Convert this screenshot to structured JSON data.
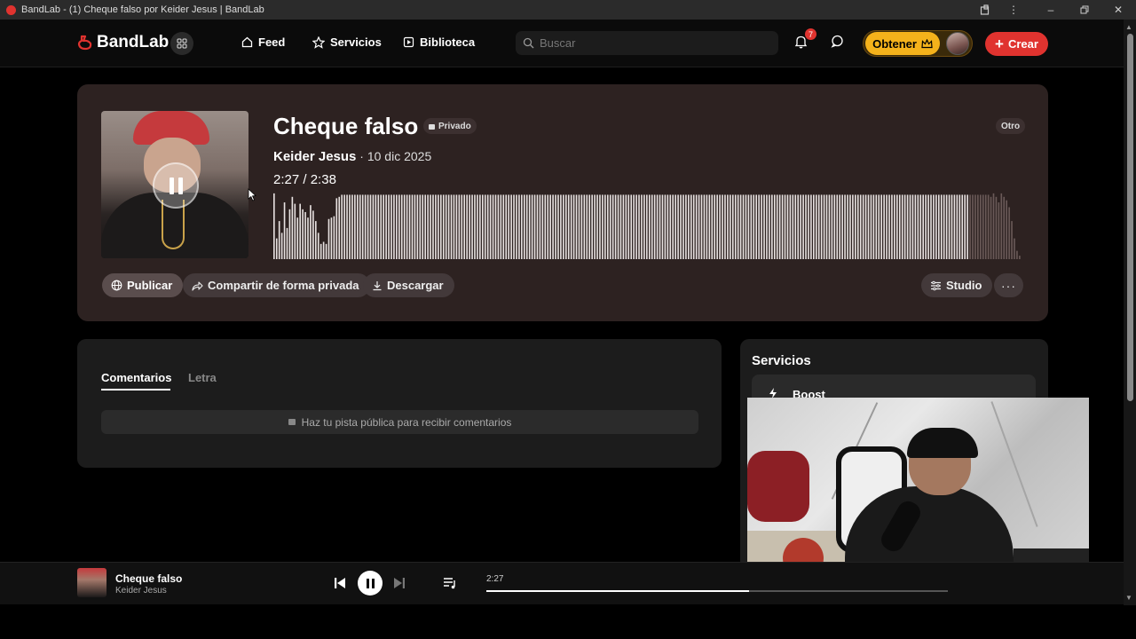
{
  "window": {
    "title": "BandLab - (1) Cheque falso por Keider Jesus | BandLab"
  },
  "nav": {
    "brand": "BandLab",
    "links": [
      {
        "label": "Feed",
        "icon": "home-icon"
      },
      {
        "label": "Servicios",
        "icon": "star-icon"
      },
      {
        "label": "Biblioteca",
        "icon": "library-icon"
      }
    ],
    "search_placeholder": "Buscar",
    "notification_count": "7",
    "get_label": "Obtener",
    "create_label": "Crear"
  },
  "track": {
    "title": "Cheque falso",
    "privacy": "Privado",
    "genre": "Otro",
    "artist": "Keider Jesus",
    "date": " · 10 dic 2025",
    "current_time": "2:27",
    "separator": " /  ",
    "duration": "2:38",
    "progress": 0.93,
    "waveform_levels": [
      0.95,
      0.3,
      0.55,
      0.38,
      0.82,
      0.45,
      0.72,
      0.9,
      0.8,
      0.6,
      0.8,
      0.72,
      0.68,
      0.6,
      0.78,
      0.7,
      0.55,
      0.38,
      0.22,
      0.25,
      0.22,
      0.58,
      0.6,
      0.62,
      0.88,
      0.9,
      0.93,
      0.93,
      0.93,
      0.93,
      0.93,
      0.93,
      0.93,
      0.93,
      0.93,
      0.93,
      0.93,
      0.93,
      0.93,
      0.93,
      0.93,
      0.93,
      0.93,
      0.93,
      0.93,
      0.93,
      0.93,
      0.93,
      0.93,
      0.93,
      0.93,
      0.93,
      0.93,
      0.93,
      0.93,
      0.93,
      0.93,
      0.93,
      0.93,
      0.93,
      0.93,
      0.93,
      0.93,
      0.93,
      0.93,
      0.93,
      0.93,
      0.93,
      0.93,
      0.93,
      0.93,
      0.93,
      0.93,
      0.93,
      0.93,
      0.93,
      0.93,
      0.93,
      0.93,
      0.93,
      0.93,
      0.93,
      0.93,
      0.93,
      0.93,
      0.93,
      0.93,
      0.93,
      0.93,
      0.93,
      0.93,
      0.93,
      0.93,
      0.93,
      0.93,
      0.93,
      0.93,
      0.93,
      0.93,
      0.93,
      0.93,
      0.93,
      0.93,
      0.93,
      0.93,
      0.93,
      0.93,
      0.93,
      0.93,
      0.93,
      0.93,
      0.93,
      0.93,
      0.93,
      0.93,
      0.93,
      0.93,
      0.93,
      0.93,
      0.93,
      0.93,
      0.93,
      0.93,
      0.93,
      0.93,
      0.93,
      0.93,
      0.93,
      0.93,
      0.93,
      0.93,
      0.93,
      0.93,
      0.93,
      0.93,
      0.93,
      0.93,
      0.93,
      0.93,
      0.93,
      0.93,
      0.93,
      0.93,
      0.93,
      0.93,
      0.93,
      0.93,
      0.93,
      0.93,
      0.93,
      0.93,
      0.93,
      0.93,
      0.93,
      0.93,
      0.93,
      0.93,
      0.93,
      0.93,
      0.93,
      0.93,
      0.93,
      0.93,
      0.93,
      0.93,
      0.93,
      0.93,
      0.93,
      0.93,
      0.93,
      0.93,
      0.93,
      0.93,
      0.93,
      0.93,
      0.93,
      0.93,
      0.93,
      0.93,
      0.93,
      0.93,
      0.93,
      0.93,
      0.93,
      0.93,
      0.93,
      0.93,
      0.93,
      0.93,
      0.93,
      0.93,
      0.93,
      0.93,
      0.93,
      0.93,
      0.93,
      0.93,
      0.93,
      0.93,
      0.93,
      0.93,
      0.93,
      0.93,
      0.93,
      0.93,
      0.93,
      0.93,
      0.93,
      0.93,
      0.93,
      0.93,
      0.93,
      0.93,
      0.93,
      0.93,
      0.93,
      0.93,
      0.93,
      0.93,
      0.93,
      0.93,
      0.93,
      0.93,
      0.93,
      0.93,
      0.93,
      0.93,
      0.93,
      0.93,
      0.93,
      0.93,
      0.93,
      0.93,
      0.93,
      0.93,
      0.93,
      0.93,
      0.93,
      0.93,
      0.93,
      0.93,
      0.93,
      0.93,
      0.93,
      0.93,
      0.93,
      0.93,
      0.93,
      0.93,
      0.93,
      0.93,
      0.93,
      0.93,
      0.93,
      0.93,
      0.93,
      0.93,
      0.93,
      0.93,
      0.93,
      0.93,
      0.93,
      0.93,
      0.93,
      0.93,
      0.93,
      0.93,
      0.93,
      0.93,
      0.93,
      0.93,
      0.93,
      0.93,
      0.93,
      0.93,
      0.9,
      0.95,
      0.9,
      0.82,
      0.95,
      0.9,
      0.85,
      0.75,
      0.55,
      0.3,
      0.12,
      0.05
    ]
  },
  "actions": {
    "publish": "Publicar",
    "share_private": "Compartir de forma privada",
    "download": "Descargar",
    "studio": "Studio",
    "more": "···"
  },
  "comments": {
    "tabs": [
      "Comentarios",
      "Letra"
    ],
    "notice": "Haz tu pista pública para recibir comentarios"
  },
  "services": {
    "title": "Servicios",
    "items": [
      "Boost"
    ]
  },
  "player": {
    "title": "Cheque falso",
    "artist": "Keider Jesus",
    "time": "2:27",
    "progress": 0.57
  },
  "colors": {
    "accent": "#e0332f",
    "gold": "#f5b21b",
    "hero_bg": "#2d2221"
  }
}
